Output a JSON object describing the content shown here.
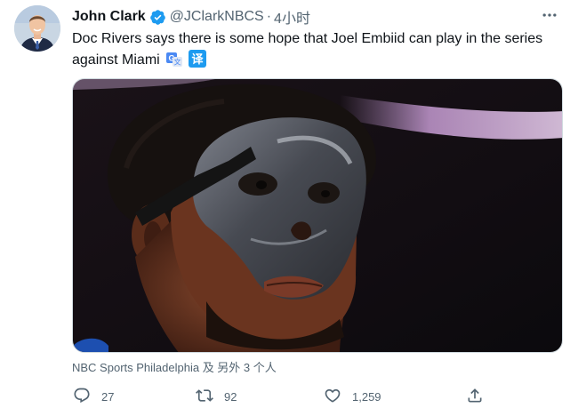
{
  "tweet": {
    "author_name": "John Clark",
    "handle": "@JClarkNBCS",
    "separator": "·",
    "time": "4小时",
    "text": "Doc Rivers says there is some hope that Joel Embiid can play in the series against Miami",
    "translate_badge": "译",
    "tagged": "NBC Sports Philadelphia 及 另外 3 个人"
  },
  "actions": {
    "reply_count": "27",
    "retweet_count": "92",
    "like_count": "1,259"
  },
  "icons": {
    "verified": "verified-badge-icon",
    "more": "more-icon",
    "reply": "reply-icon",
    "retweet": "retweet-icon",
    "like": "heart-icon",
    "share": "share-icon"
  },
  "colors": {
    "verified_blue": "#1d9bf0",
    "secondary_text": "#536471",
    "primary_text": "#0f1419"
  }
}
